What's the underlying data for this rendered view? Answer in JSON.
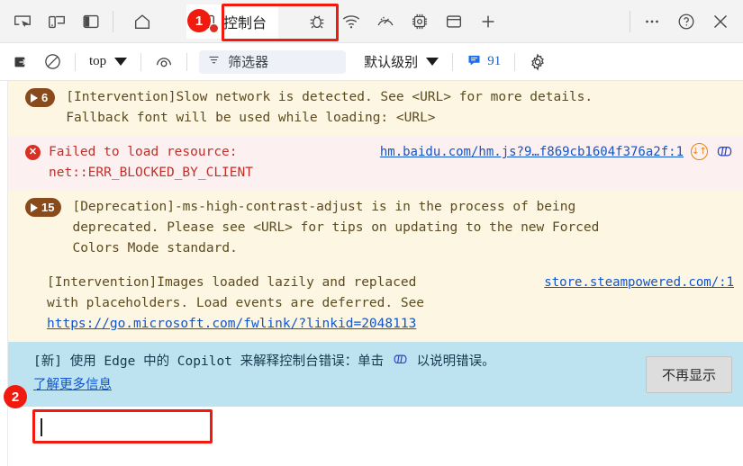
{
  "toolbar": {
    "left_icons": [
      {
        "name": "inspect-element-icon",
        "label": "检查元素"
      },
      {
        "name": "device-toolbar-icon",
        "label": "设备模拟"
      },
      {
        "name": "dock-side-icon",
        "label": "停靠侧边"
      }
    ],
    "home_icon_label": "主页",
    "active_tab": {
      "label": "控制台",
      "icon": "console-terminal-icon",
      "error_badge": true
    },
    "right_icons": [
      {
        "name": "bug-icon",
        "label": "问题"
      },
      {
        "name": "network-wifi-icon",
        "label": "网络"
      },
      {
        "name": "performance-gauge-icon",
        "label": "性能"
      },
      {
        "name": "memory-chip-icon",
        "label": "内存"
      },
      {
        "name": "application-panel-icon",
        "label": "应用程序"
      },
      {
        "name": "add-tab-icon",
        "label": "添加"
      }
    ],
    "overflow_label": "...",
    "help_label": "?",
    "close_label": "✕"
  },
  "filterbar": {
    "clear_console_label": "清除控制台",
    "no_entry_label": "禁止",
    "context_value": "top",
    "eye_label": "实时表达式",
    "filter_placeholder": "筛选器",
    "filter_icon": "filter-lines-icon",
    "level_value": "默认级别",
    "issues_count": "91",
    "issues_icon": "issues-speech-icon",
    "settings_label": "控制台设置"
  },
  "messages": [
    {
      "kind": "warn",
      "badge_count": "6",
      "line1": "[Intervention]Slow network is detected. See <URL> for more details.",
      "line2": "Fallback font will be used while loading: <URL>"
    },
    {
      "kind": "err",
      "icon_glyph": "✕",
      "line1": "Failed to load resource:",
      "line2": "net::ERR_BLOCKED_BY_CLIENT",
      "source_link": "hm.baidu.com/hm.js?9…f869cb1604f376a2f:1",
      "net_icon": "network-request-icon",
      "copilot_icon": "copilot-explain-icon"
    },
    {
      "kind": "warn",
      "badge_count": "15",
      "line1": "[Deprecation]-ms-high-contrast-adjust is in the process of being",
      "line2": "deprecated. Please see <URL> for tips on updating to the new Forced",
      "line3": "Colors Mode standard."
    },
    {
      "kind": "warn",
      "badge_count": "",
      "line1": "[Intervention]Images loaded lazily and replaced",
      "line2": "with placeholders. Load events are deferred. See",
      "link_text": "https://go.microsoft.com/fwlink/?linkid=2048113",
      "source_link": "store.steampowered.com/:1"
    }
  ],
  "copilot_banner": {
    "prefix": "[新] 使用 Edge 中的 Copilot 来解释控制台错误：单击",
    "icon": "copilot-explain-icon",
    "suffix": "以说明错误。",
    "learn_more": "了解更多信息",
    "dismiss_label": "不再显示"
  },
  "prompt": {
    "value": "",
    "placeholder": ""
  },
  "annotations": [
    {
      "id": "1",
      "target": "console-tab"
    },
    {
      "id": "2",
      "target": "console-prompt-input"
    }
  ],
  "colors": {
    "annotation_red": "#f01b0e",
    "warn_bg": "#fdf6e3",
    "error_bg": "#fdf0f0",
    "info_bg": "#bde3f0",
    "link_blue": "#1155cc",
    "badge_brown": "#8a4b1c"
  }
}
